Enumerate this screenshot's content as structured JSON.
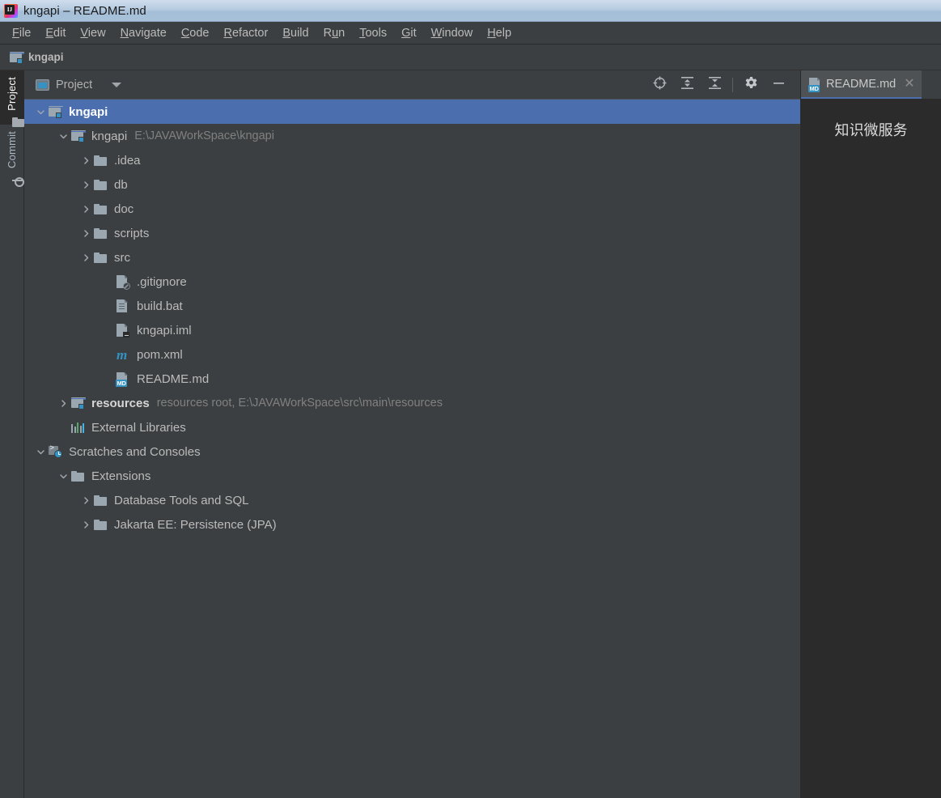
{
  "window": {
    "title": "kngapi – README.md",
    "logo_icon": "intellij-idea-logo"
  },
  "menubar": {
    "items": [
      {
        "label": "File",
        "mnemonic": "F"
      },
      {
        "label": "Edit",
        "mnemonic": "E"
      },
      {
        "label": "View",
        "mnemonic": "V"
      },
      {
        "label": "Navigate",
        "mnemonic": "N"
      },
      {
        "label": "Code",
        "mnemonic": "C"
      },
      {
        "label": "Refactor",
        "mnemonic": "R"
      },
      {
        "label": "Build",
        "mnemonic": "B"
      },
      {
        "label": "Run",
        "mnemonic": "u"
      },
      {
        "label": "Tools",
        "mnemonic": "T"
      },
      {
        "label": "Git",
        "mnemonic": "G"
      },
      {
        "label": "Window",
        "mnemonic": "W"
      },
      {
        "label": "Help",
        "mnemonic": "H"
      }
    ]
  },
  "navbar": {
    "crumb": "kngapi",
    "icon": "module-folder-icon"
  },
  "stripe": {
    "buttons": [
      {
        "label": "Project",
        "icon": "folder-icon",
        "active": true
      },
      {
        "label": "Commit",
        "icon": "commit-icon",
        "active": false
      }
    ]
  },
  "panel": {
    "title": "Project",
    "title_icon": "project-window-icon",
    "dropdown_icon": "chevron-down-icon",
    "actions": [
      {
        "name": "select-opened-file",
        "icon": "crosshair-target-icon"
      },
      {
        "name": "expand-all",
        "icon": "expand-all-icon"
      },
      {
        "name": "collapse-all",
        "icon": "collapse-all-icon"
      },
      {
        "name": "settings",
        "icon": "gear-icon"
      },
      {
        "name": "hide",
        "icon": "minus-icon"
      }
    ]
  },
  "tree": {
    "rows": [
      {
        "label": "kngapi",
        "hint": "",
        "indent": 0,
        "arrow": "down",
        "icon": "module-folder-icon",
        "selected": true,
        "bold": true
      },
      {
        "label": "kngapi",
        "hint": "E:\\JAVAWorkSpace\\kngapi",
        "indent": 1,
        "arrow": "down",
        "icon": "module-folder-icon",
        "selected": false,
        "bold": false
      },
      {
        "label": ".idea",
        "hint": "",
        "indent": 2,
        "arrow": "right",
        "icon": "folder-icon",
        "selected": false,
        "bold": false
      },
      {
        "label": "db",
        "hint": "",
        "indent": 2,
        "arrow": "right",
        "icon": "folder-icon",
        "selected": false,
        "bold": false
      },
      {
        "label": "doc",
        "hint": "",
        "indent": 2,
        "arrow": "right",
        "icon": "folder-icon",
        "selected": false,
        "bold": false
      },
      {
        "label": "scripts",
        "hint": "",
        "indent": 2,
        "arrow": "right",
        "icon": "folder-icon",
        "selected": false,
        "bold": false
      },
      {
        "label": "src",
        "hint": "",
        "indent": 2,
        "arrow": "right",
        "icon": "folder-icon",
        "selected": false,
        "bold": false
      },
      {
        "label": ".gitignore",
        "hint": "",
        "indent": 3,
        "arrow": "none",
        "icon": "gitignore-file-icon",
        "selected": false,
        "bold": false
      },
      {
        "label": "build.bat",
        "hint": "",
        "indent": 3,
        "arrow": "none",
        "icon": "script-file-icon",
        "selected": false,
        "bold": false
      },
      {
        "label": "kngapi.iml",
        "hint": "",
        "indent": 3,
        "arrow": "none",
        "icon": "module-file-icon",
        "selected": false,
        "bold": false
      },
      {
        "label": "pom.xml",
        "hint": "",
        "indent": 3,
        "arrow": "none",
        "icon": "maven-file-icon",
        "selected": false,
        "bold": false
      },
      {
        "label": "README.md",
        "hint": "",
        "indent": 3,
        "arrow": "none",
        "icon": "markdown-file-icon",
        "selected": false,
        "bold": false
      },
      {
        "label": "resources",
        "hint": "resources root,  E:\\JAVAWorkSpace\\src\\main\\resources",
        "indent": 1,
        "arrow": "right",
        "icon": "module-folder-icon",
        "selected": false,
        "bold": true
      },
      {
        "label": "External Libraries",
        "hint": "",
        "indent": 1,
        "arrow": "none",
        "icon": "libraries-icon",
        "selected": false,
        "bold": false
      },
      {
        "label": "Scratches and Consoles",
        "hint": "",
        "indent": 0,
        "arrow": "down",
        "icon": "scratches-icon",
        "selected": false,
        "bold": false
      },
      {
        "label": "Extensions",
        "hint": "",
        "indent": 1,
        "arrow": "down",
        "icon": "folder-icon",
        "selected": false,
        "bold": false
      },
      {
        "label": "Database Tools and SQL",
        "hint": "",
        "indent": 2,
        "arrow": "right",
        "icon": "folder-icon",
        "selected": false,
        "bold": false
      },
      {
        "label": "Jakarta EE: Persistence (JPA)",
        "hint": "",
        "indent": 2,
        "arrow": "right",
        "icon": "folder-icon",
        "selected": false,
        "bold": false
      }
    ]
  },
  "editor": {
    "tab": {
      "label": "README.md",
      "icon": "markdown-file-icon",
      "badge": "MD",
      "close_icon": "close-icon"
    },
    "preview_heading": "知识微服务"
  },
  "colors": {
    "accent": "#4b6eaf",
    "panel_bg": "#3c3f41",
    "editor_bg": "#2b2b2b",
    "text": "#bbbbbb",
    "hint_text": "#808080",
    "badge_blue": "#3592c4",
    "titlebar_blue": "#a8c1da"
  }
}
